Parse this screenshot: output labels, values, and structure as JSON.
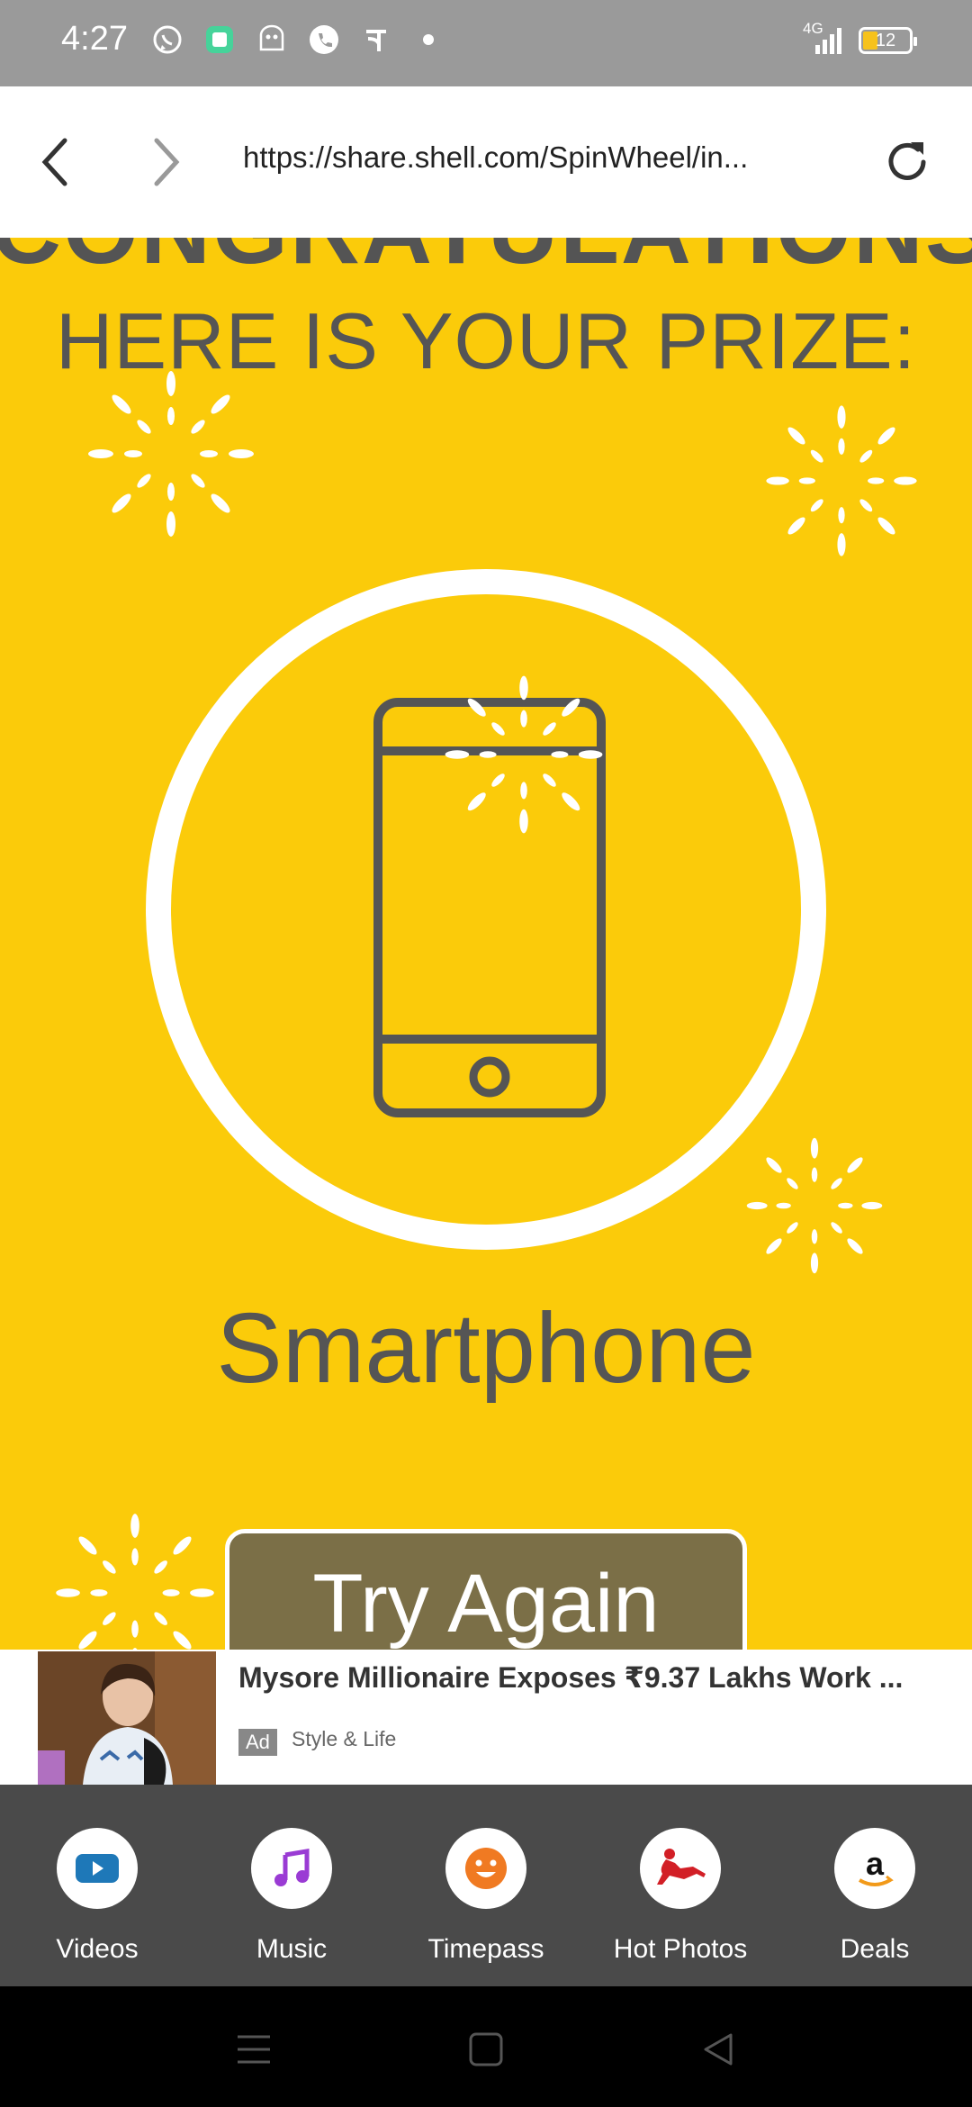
{
  "status_bar": {
    "time": "4:27",
    "network": "4G",
    "battery": "12"
  },
  "browser": {
    "url": "https://share.shell.com/SpinWheel/in..."
  },
  "page": {
    "congrats_text": "CONGRATULATIONS!",
    "prize_heading": "HERE IS YOUR PRIZE:",
    "prize_name": "Smartphone",
    "try_again_label": "Try Again"
  },
  "ad": {
    "headline": "Mysore Millionaire Exposes ₹9.37 Lakhs Work ...",
    "badge": "Ad",
    "source": "Style & Life"
  },
  "shortcuts": [
    {
      "label": "Videos",
      "icon": "play-icon"
    },
    {
      "label": "Music",
      "icon": "music-note-icon"
    },
    {
      "label": "Timepass",
      "icon": "smiley-icon"
    },
    {
      "label": "Hot Photos",
      "icon": "silhouette-icon"
    },
    {
      "label": "Deals",
      "icon": "amazon-icon"
    }
  ],
  "colors": {
    "page_background": "#fbcb0a",
    "text_gray": "#555555",
    "button_olive": "#7b6f47",
    "status_bar": "#9a9a9a",
    "shortcut_bar": "#4a4a4a"
  }
}
